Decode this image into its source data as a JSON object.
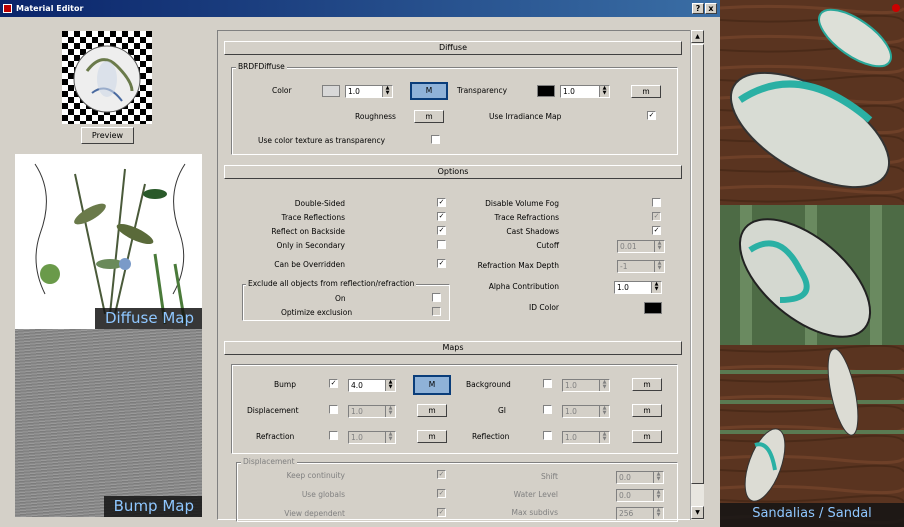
{
  "window": {
    "title": "Material Editor",
    "help_btn": "?",
    "close_btn": "x"
  },
  "left": {
    "preview_button": "Preview",
    "diffuse_label": "Diffuse Map",
    "bump_label": "Bump Map"
  },
  "sections": {
    "diffuse": "Diffuse",
    "options": "Options",
    "maps": "Maps"
  },
  "brdf": {
    "group_label": "BRDFDiffuse",
    "color_label": "Color",
    "color_value": "1.0",
    "color_m": "M",
    "transparency_label": "Transparency",
    "transparency_value": "1.0",
    "transparency_m": "m",
    "roughness_label": "Roughness",
    "roughness_m": "m",
    "irradiance_label": "Use Irradiance Map",
    "irradiance_checked": "✓",
    "texture_label": "Use color texture as transparency",
    "color_swatch": "#d8d8d8",
    "transparency_swatch": "#000000"
  },
  "options": {
    "double_sided": "Double-Sided",
    "trace_reflections": "Trace Reflections",
    "reflect_backside": "Reflect on Backside",
    "only_secondary": "Only in Secondary",
    "overridden": "Can be Overridden",
    "disable_fog": "Disable Volume Fog",
    "trace_refractions": "Trace Refractions",
    "cast_shadows": "Cast Shadows",
    "cutoff": "Cutoff",
    "cutoff_value": "0.01",
    "refraction_depth": "Refraction Max Depth",
    "refraction_depth_value": "-1",
    "alpha": "Alpha Contribution",
    "alpha_value": "1.0",
    "id_color": "ID Color",
    "exclude_group": "Exclude all objects from reflection/refraction",
    "on": "On",
    "optimize": "Optimize exclusion",
    "check": "✓"
  },
  "maps": {
    "bump": "Bump",
    "bump_value": "4.0",
    "bump_m": "M",
    "displacement": "Displacement",
    "displacement_value": "1.0",
    "refraction": "Refraction",
    "refraction_value": "1.0",
    "background": "Background",
    "background_value": "1.0",
    "gi": "GI",
    "gi_value": "1.0",
    "reflection": "Reflection",
    "reflection_value": "1.0",
    "m": "m"
  },
  "displacement": {
    "group_label": "Displacement",
    "keep_continuity": "Keep continuity",
    "use_globals": "Use globals",
    "view_dependent": "View dependent",
    "shift": "Shift",
    "shift_value": "0.0",
    "water_level": "Water Level",
    "water_value": "0.0",
    "max_subdivs": "Max subdivs",
    "max_subdivs_value": "256"
  },
  "render": {
    "label": "Sandalias / Sandal"
  }
}
